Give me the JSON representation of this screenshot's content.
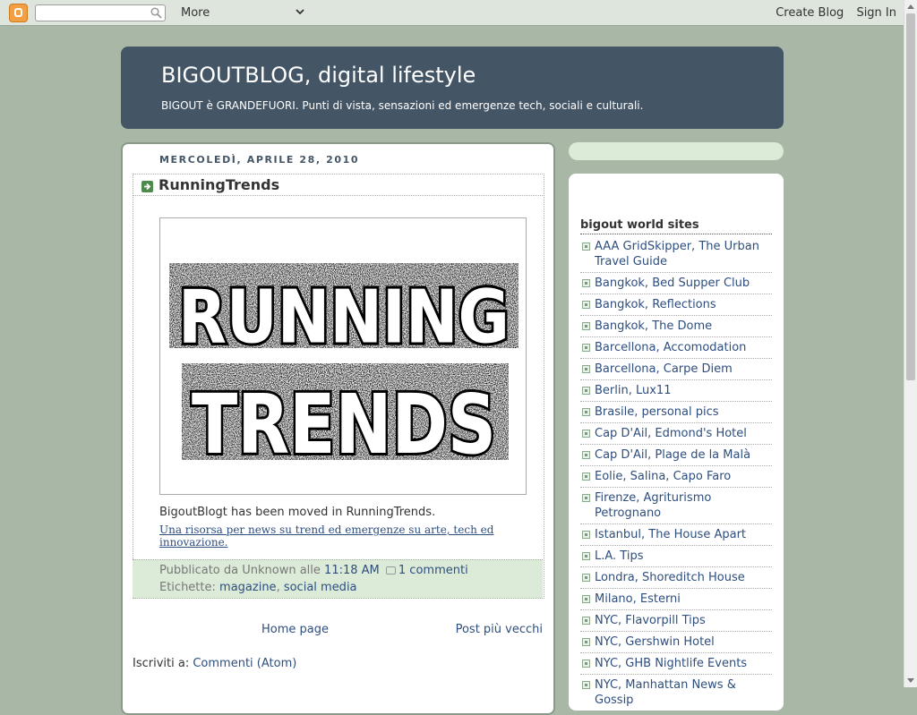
{
  "navbar": {
    "more_label": "More",
    "create_blog_label": "Create Blog",
    "sign_in_label": "Sign In"
  },
  "header": {
    "title": "BIGOUTBLOG, digital lifestyle",
    "description": "BIGOUT è GRANDEFUORI. Punti di vista, sensazioni ed emergenze tech, sociali e culturali."
  },
  "post": {
    "date": "MERCOLEDÌ, APRILE 28, 2010",
    "title": "RunningTrends",
    "image_text": [
      "RUNNING",
      "TRENDS"
    ],
    "text": "BigoutBlogt has been moved in RunningTrends.",
    "link_text": "Una risorsa per news su trend ed emergenze su arte, tech ed innovazione.",
    "footer": {
      "posted_prefix": "Pubblicato da Unknown alle",
      "time": "11:18 AM",
      "comments": "1 commenti",
      "labels_prefix": "Etichette:",
      "labels": [
        "magazine",
        "social media"
      ]
    }
  },
  "pager": {
    "home": "Home page",
    "older": "Post più vecchi"
  },
  "subscribe": {
    "prefix": "Iscriviti a:",
    "link": "Commenti (Atom)"
  },
  "sidebar": {
    "widget_title": "bigout world sites",
    "links": [
      "AAA GridSkipper, The Urban Travel Guide",
      "Bangkok, Bed Supper Club",
      "Bangkok, Reflections",
      "Bangkok, The Dome",
      "Barcellona, Accomodation",
      "Barcellona, Carpe Diem",
      "Berlin, Lux11",
      "Brasile, personal pics",
      "Cap D'Ail, Edmond's Hotel",
      "Cap D'Ail, Plage de la Malà",
      "Eolie, Salina, Capo Faro",
      "Firenze, Agriturismo Petrognano",
      "Istanbul, The House Apart",
      "L.A. Tips",
      "Londra, Shoreditch House",
      "Milano, Esterni",
      "NYC, Flavorpill Tips",
      "NYC, Gershwin Hotel",
      "NYC, GHB Nightlife Events",
      "NYC, Manhattan News & Gossip"
    ]
  }
}
